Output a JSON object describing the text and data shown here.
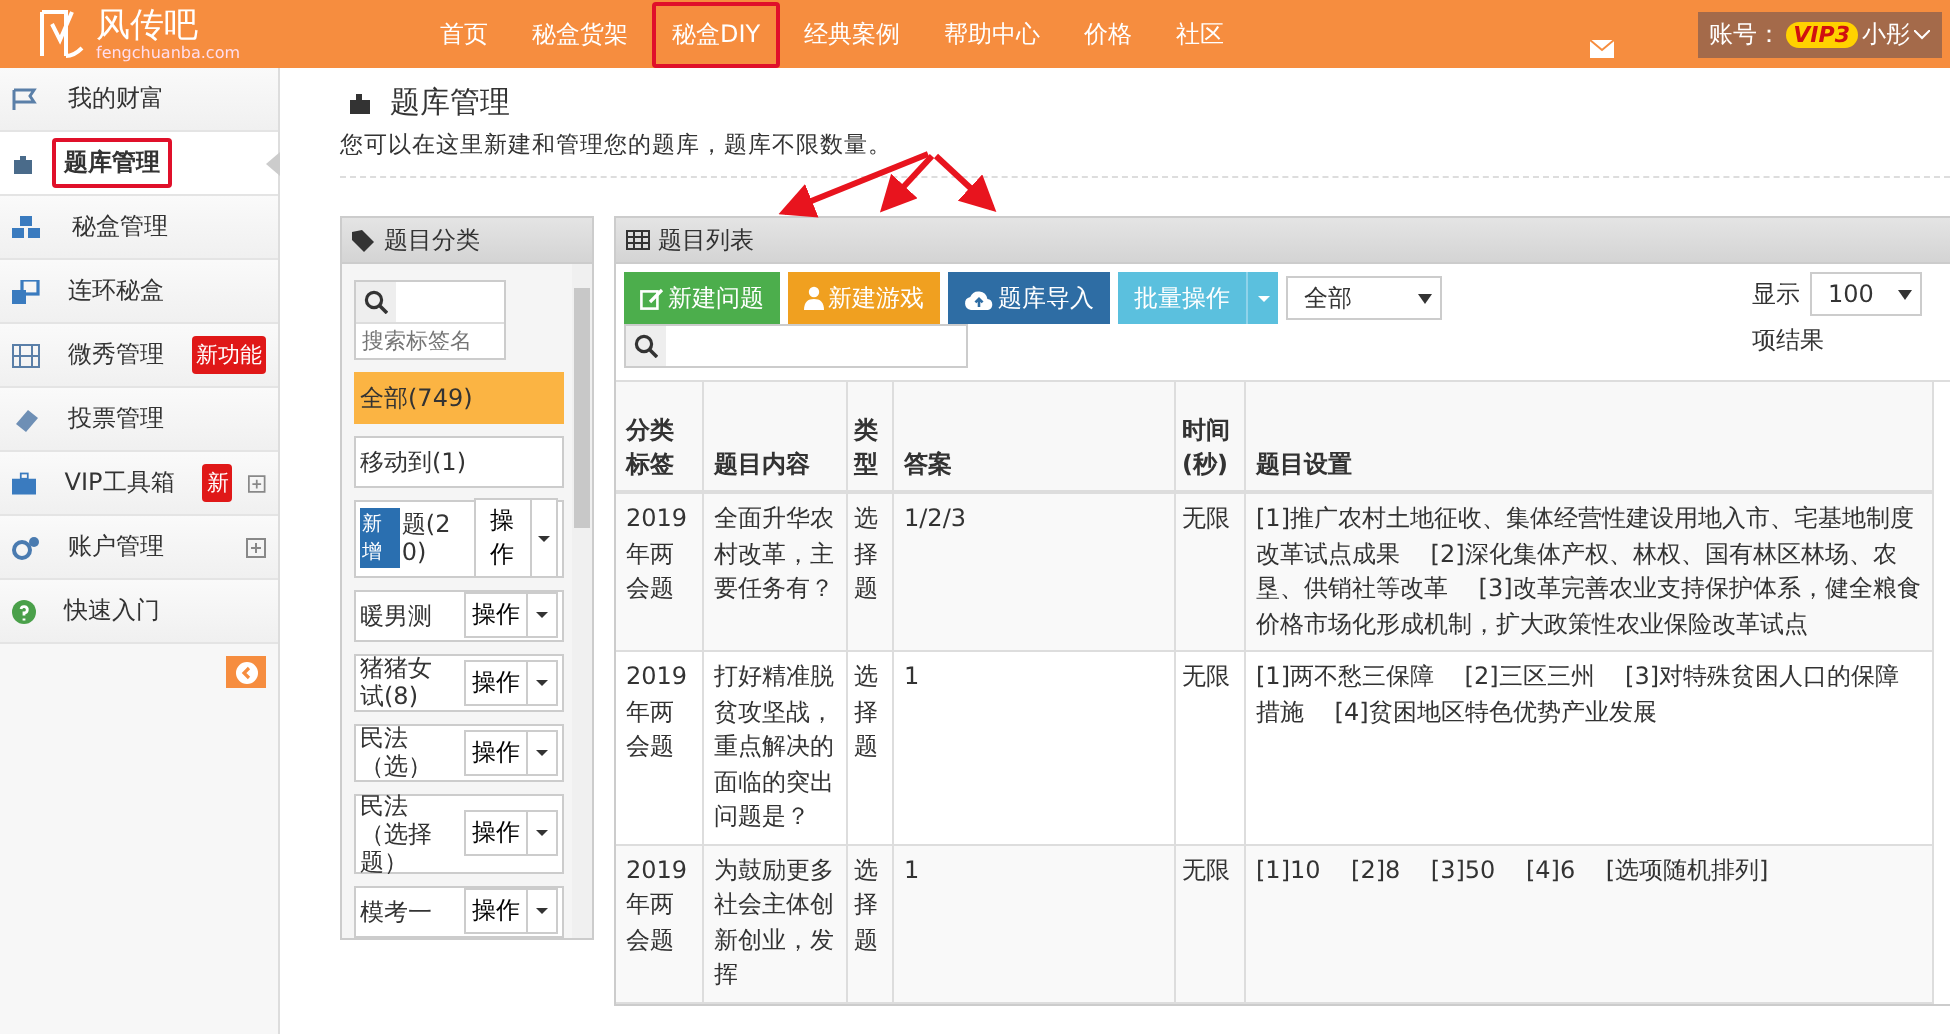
{
  "header": {
    "logo": "风传吧",
    "logo_sub": "fengchuanba.com",
    "nav": [
      {
        "label": "首页",
        "highlighted": false
      },
      {
        "label": "秘盒货架",
        "highlighted": false
      },
      {
        "label": "秘盒DIY",
        "highlighted": true
      },
      {
        "label": "经典案例",
        "highlighted": false
      },
      {
        "label": "帮助中心",
        "highlighted": false
      },
      {
        "label": "价格",
        "highlighted": false
      },
      {
        "label": "社区",
        "highlighted": false
      }
    ],
    "account_label": "账号：",
    "vip": "VIP3",
    "user": "小彤"
  },
  "sidebar": {
    "items": [
      {
        "label": "我的财富",
        "selected": false,
        "highlighted": false
      },
      {
        "label": "题库管理",
        "selected": true,
        "highlighted": true
      },
      {
        "label": "秘盒管理",
        "selected": false,
        "highlighted": false
      },
      {
        "label": "连环秘盒",
        "selected": false,
        "highlighted": false
      },
      {
        "label": "微秀管理",
        "selected": false,
        "highlighted": false,
        "badge": "新功能"
      },
      {
        "label": "投票管理",
        "selected": false,
        "highlighted": false
      },
      {
        "label": "VIP工具箱",
        "selected": false,
        "highlighted": false,
        "badge": "新",
        "expandable": true
      },
      {
        "label": "账户管理",
        "selected": false,
        "highlighted": false,
        "expandable": true
      },
      {
        "label": "快速入门",
        "selected": false,
        "highlighted": false
      }
    ]
  },
  "page": {
    "title": "题库管理",
    "description": "您可以在这里新建和管理您的题库，题库不限数量。"
  },
  "categories": {
    "title": "题目分类",
    "search_placeholder": "搜索标签名",
    "items": [
      {
        "label": "全部(749)",
        "selected": true
      },
      {
        "label": "移动到(1)",
        "selected": false
      },
      {
        "label": "题(20)",
        "tag": "新增",
        "action": "操作",
        "selected": false
      },
      {
        "label": "暖男测",
        "action": "操作",
        "selected": false
      },
      {
        "label": "猪猪女试(8)",
        "action": "操作",
        "selected": false
      },
      {
        "label": "民法（选）",
        "action": "操作",
        "selected": false
      },
      {
        "label": "民法（选择题）",
        "action": "操作",
        "selected": false
      },
      {
        "label": "模考一",
        "action": "操作",
        "selected": false
      }
    ]
  },
  "questions": {
    "title": "题目列表",
    "buttons": [
      {
        "label": "新建问题",
        "kind": "create"
      },
      {
        "label": "新建游戏",
        "kind": "game"
      },
      {
        "label": "题库导入",
        "kind": "import"
      }
    ],
    "batch": "批量操作",
    "filter": "全部",
    "show_label": "显示",
    "page_size": "100",
    "results_label": "项结果",
    "columns": [
      "分类标签",
      "题目内容",
      "类型",
      "答案",
      "时间(秒)",
      "题目设置"
    ],
    "rows": [
      [
        "2019年两会题",
        "全面升华农村改革，主要任务有？",
        "选择题",
        "1/2/3",
        "无限",
        "[1]推广农村土地征收、集体经营性建设用地入市、宅基地制度改革试点成果    [2]深化集体产权、林权、国有林区林场、农垦、供销社等改革    [3]改革完善农业支持保护体系，健全粮食价格市场化形成机制，扩大政策性农业保险改革试点"
      ],
      [
        "2019年两会题",
        "打好精准脱贫攻坚战，重点解决的面临的突出问题是？",
        "选择题",
        "1",
        "无限",
        "[1]两不愁三保障    [2]三区三州    [3]对特殊贫困人口的保障措施    [4]贫困地区特色优势产业发展"
      ],
      [
        "2019年两会题",
        "为鼓励更多社会主体创新创业，发挥",
        "选择题",
        "1",
        "无限",
        "[1]10    [2]8    [3]50    [4]6    [选项随机排列]"
      ]
    ]
  }
}
